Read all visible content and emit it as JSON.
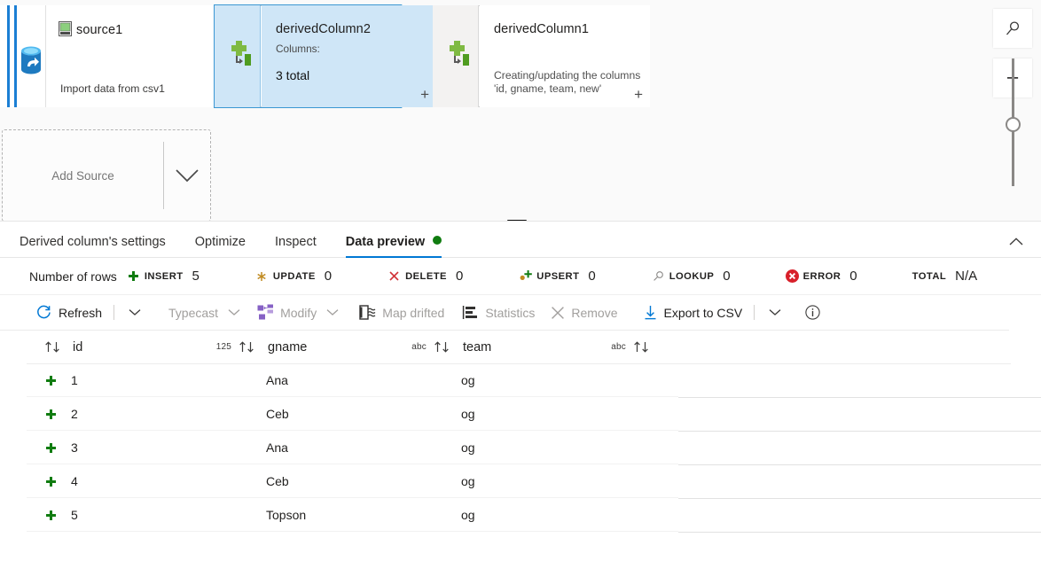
{
  "canvas": {
    "stream_rail": {
      "icon": "database-source-icon"
    },
    "nodes": [
      {
        "id": "source1",
        "title": "source1",
        "subtitle": "Import data from csv1",
        "icon": "csv-file-icon",
        "selected": false
      },
      {
        "id": "derivedColumn2",
        "title": "derivedColumn2",
        "sub_label": "Columns:",
        "sub_value": "3 total",
        "icon": "derived-column-icon",
        "selected": true
      },
      {
        "id": "derivedColumn1",
        "title": "derivedColumn1",
        "subtitle": "Creating/updating the columns\n'id, gname, team, new'",
        "icon": "derived-column-icon",
        "selected": false
      }
    ],
    "add_source": {
      "label": "Add Source",
      "chevron_icon": "chevron-down-icon"
    },
    "zoom_controls": {
      "search_icon": "magnifier-icon",
      "zoom_in": "+",
      "zoom_out": "–"
    }
  },
  "panel": {
    "tabs": [
      {
        "label": "Derived column's settings",
        "active": false,
        "dot": false
      },
      {
        "label": "Optimize",
        "active": false,
        "dot": false
      },
      {
        "label": "Inspect",
        "active": false,
        "dot": false
      },
      {
        "label": "Data preview",
        "active": true,
        "dot": true
      }
    ],
    "collapse_icon": "chevron-up-icon",
    "status_dot_color": "#107c10",
    "accent_color": "#0078d4"
  },
  "counts": {
    "rows_label": "Number of rows",
    "items": [
      {
        "name": "INSERT",
        "value": "5",
        "icon": "plus-icon",
        "color": "#107c10"
      },
      {
        "name": "UPDATE",
        "value": "0",
        "icon": "asterisk-icon",
        "color": "#c08a20"
      },
      {
        "name": "DELETE",
        "value": "0",
        "icon": "cross-icon",
        "color": "#d13438"
      },
      {
        "name": "UPSERT",
        "value": "0",
        "icon": "upsert-icon",
        "color": "#107c10"
      },
      {
        "name": "LOOKUP",
        "value": "0",
        "icon": "magnifier-icon",
        "color": "#8a8886"
      },
      {
        "name": "ERROR",
        "value": "0",
        "icon": "error-icon",
        "color": "#d13438"
      },
      {
        "name": "TOTAL",
        "value": "N/A",
        "icon": "none",
        "color": "#201f1e"
      }
    ]
  },
  "toolbar": {
    "refresh": {
      "label": "Refresh",
      "icon": "refresh-icon",
      "disabled": false
    },
    "refresh_chevron": "chevron-down-icon",
    "typecast": {
      "label": "Typecast",
      "icon": "none",
      "disabled": true
    },
    "typecast_chevron": "chevron-down-icon",
    "modify": {
      "label": "Modify",
      "icon": "modify-icon",
      "disabled": true
    },
    "modify_chevron": "chevron-down-icon",
    "map_drifted": {
      "label": "Map drifted",
      "icon": "map-drifted-icon",
      "disabled": true
    },
    "statistics": {
      "label": "Statistics",
      "icon": "statistics-icon",
      "disabled": true
    },
    "remove": {
      "label": "Remove",
      "icon": "close-icon",
      "disabled": true
    },
    "export_csv": {
      "label": "Export to CSV",
      "icon": "download-icon",
      "disabled": false
    },
    "export_chevron": "chevron-down-icon",
    "info": {
      "icon": "info-icon"
    }
  },
  "grid": {
    "columns": [
      {
        "name": "id",
        "type": "125",
        "sort_icon": "sort-icon",
        "leading_sort_icon": "sort-icon"
      },
      {
        "name": "gname",
        "type": "abc",
        "sort_icon": "sort-icon"
      },
      {
        "name": "team",
        "type": "abc",
        "sort_icon": "sort-icon"
      },
      {
        "name": "",
        "type": "abc",
        "sort_icon": "sort-icon"
      }
    ],
    "rows": [
      {
        "marker": "insert",
        "id": "1",
        "gname": "Ana",
        "team": "og"
      },
      {
        "marker": "insert",
        "id": "2",
        "gname": "Ceb",
        "team": "og"
      },
      {
        "marker": "insert",
        "id": "3",
        "gname": "Ana",
        "team": "og"
      },
      {
        "marker": "insert",
        "id": "4",
        "gname": "Ceb",
        "team": "og"
      },
      {
        "marker": "insert",
        "id": "5",
        "gname": "Topson",
        "team": "og"
      }
    ]
  }
}
